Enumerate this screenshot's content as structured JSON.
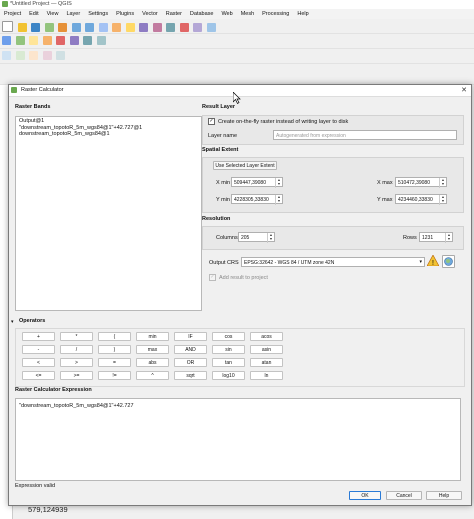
{
  "app": {
    "title": "*Untitled Project — QGIS",
    "coordinate": "579,124939"
  },
  "menu": [
    "Project",
    "Edit",
    "View",
    "Layer",
    "Settings",
    "Plugins",
    "Vector",
    "Raster",
    "Database",
    "Web",
    "Mesh",
    "Processing",
    "Help"
  ],
  "dialog": {
    "title": "Raster Calculator",
    "bands_label": "Raster Bands",
    "bands": [
      "Output@1",
      "\"downstream_topotoR_5m_wgs84@1\"+42.727@1",
      "downstream_topotoR_5m_wgs84@1"
    ],
    "result_label": "Result Layer",
    "onfly_label": "Create on-the-fly raster instead of writing layer to disk",
    "layer_name_label": "Layer name",
    "layer_name_placeholder": "Autogenerated from expression",
    "spatial_extent_label": "Spatial Extent",
    "use_selected_button": "Use Selected Layer Extent",
    "xmin_label": "X min",
    "xmin": "509447,39080",
    "xmax_label": "X max",
    "xmax": "510472,39080",
    "ymin_label": "Y min",
    "ymin": "4228305,33830",
    "ymax_label": "Y max",
    "ymax": "4234460,33830",
    "resolution_label": "Resolution",
    "columns_label": "Columns",
    "columns": "205",
    "rows_label": "Rows",
    "rows": "1231",
    "crs_label": "Output CRS",
    "crs_value": "EPSG:32642 - WGS 84 / UTM zone 42N",
    "add_result_label": "Add result to project",
    "operators_label": "Operators",
    "operators": [
      [
        "+",
        "*",
        "(",
        "min",
        "IF",
        "cos",
        "acos"
      ],
      [
        "-",
        "/",
        ")",
        "max",
        "AND",
        "sin",
        "asin"
      ],
      [
        "<",
        ">",
        "=",
        "abs",
        "OR",
        "tan",
        "atan"
      ],
      [
        "<=",
        ">=",
        "!=",
        "^",
        "sqrt",
        "log10",
        "ln"
      ]
    ],
    "expression_label": "Raster Calculator Expression",
    "expression": "\"downstream_topotoR_5m_wgs84@1\"+42.727",
    "status": "Expression valid",
    "ok": "OK",
    "cancel": "Cancel",
    "help": "Help"
  }
}
